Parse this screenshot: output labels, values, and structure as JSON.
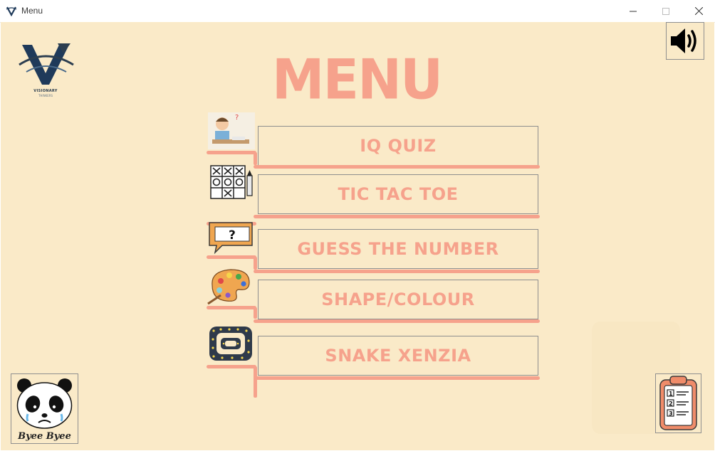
{
  "window": {
    "title": "Menu"
  },
  "menu": {
    "title": "MENU",
    "items": [
      {
        "label": "IQ QUIZ",
        "icon": "student-quiz-icon"
      },
      {
        "label": "TIC TAC TOE",
        "icon": "tic-tac-toe-grid-icon"
      },
      {
        "label": "GUESS THE NUMBER",
        "icon": "question-sign-icon"
      },
      {
        "label": "SHAPE/COLOUR",
        "icon": "paint-palette-icon"
      },
      {
        "label": "SNAKE XENZIA",
        "icon": "snake-icon"
      }
    ]
  },
  "logo": {
    "name": "VISIONARY",
    "sub": "THINKERS"
  },
  "exit": {
    "label": "Byee Byee",
    "icon": "sad-panda-icon"
  },
  "sound": {
    "icon": "speaker-volume-icon"
  },
  "rules": {
    "icon": "clipboard-list-icon"
  },
  "colors": {
    "background": "#faeac8",
    "accent": "#f6a28c"
  }
}
